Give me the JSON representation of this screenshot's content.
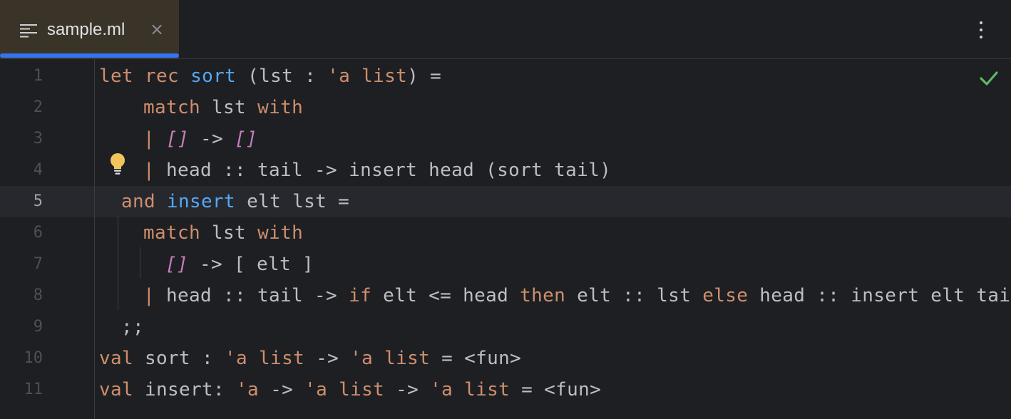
{
  "tab": {
    "title": "sample.ml",
    "close_symbol": "×",
    "file_icon": "text-file-icon"
  },
  "toolbar": {
    "more_icon": "more-vertical-icon"
  },
  "status": {
    "inspection_icon": "check-icon",
    "inspection_color": "#5fb865"
  },
  "intention": {
    "icon": "lightbulb-icon",
    "color": "#f2c55c"
  },
  "editor": {
    "current_line": 5,
    "colors": {
      "keyword": "#cf8e6d",
      "function": "#56a8f5",
      "list_literal": "#c77dbb",
      "text": "#bcbec4",
      "accent": "#3574f0"
    },
    "lines": [
      {
        "number": "1",
        "tokens": [
          {
            "t": "let",
            "c": "kw"
          },
          {
            "t": " "
          },
          {
            "t": "rec",
            "c": "kw"
          },
          {
            "t": " "
          },
          {
            "t": "sort",
            "c": "fn"
          },
          {
            "t": " (lst : "
          },
          {
            "t": "'a list",
            "c": "kw"
          },
          {
            "t": ") ="
          }
        ]
      },
      {
        "number": "2",
        "tokens": [
          {
            "t": "match",
            "c": "kw"
          },
          {
            "t": " lst "
          },
          {
            "t": "with",
            "c": "kw"
          }
        ]
      },
      {
        "number": "3",
        "tokens": [
          {
            "t": "| ",
            "c": "kw"
          },
          {
            "t": "[]",
            "c": "ls"
          },
          {
            "t": " -> "
          },
          {
            "t": "[]",
            "c": "ls"
          }
        ]
      },
      {
        "number": "4",
        "tokens": [
          {
            "t": "| ",
            "c": "kw"
          },
          {
            "t": "head :: tail -> insert head (sort tail)"
          }
        ]
      },
      {
        "number": "5",
        "tokens": [
          {
            "t": "and",
            "c": "kw"
          },
          {
            "t": " "
          },
          {
            "t": "insert",
            "c": "fn"
          },
          {
            "t": " elt lst ="
          }
        ]
      },
      {
        "number": "6",
        "tokens": [
          {
            "t": "match",
            "c": "kw"
          },
          {
            "t": " lst "
          },
          {
            "t": "with",
            "c": "kw"
          }
        ]
      },
      {
        "number": "7",
        "tokens": [
          {
            "t": "[]",
            "c": "ls"
          },
          {
            "t": " -> [ elt ]"
          }
        ]
      },
      {
        "number": "8",
        "tokens": [
          {
            "t": "| ",
            "c": "kw"
          },
          {
            "t": "head :: tail -> "
          },
          {
            "t": "if",
            "c": "kw"
          },
          {
            "t": " elt <= head "
          },
          {
            "t": "then",
            "c": "kw"
          },
          {
            "t": " elt :: lst "
          },
          {
            "t": "else",
            "c": "kw"
          },
          {
            "t": " head :: insert elt tail"
          }
        ]
      },
      {
        "number": "9",
        "tokens": [
          {
            "t": ";;"
          }
        ]
      },
      {
        "number": "10",
        "tokens": [
          {
            "t": "val",
            "c": "kw"
          },
          {
            "t": " sort : "
          },
          {
            "t": "'a list",
            "c": "kw"
          },
          {
            "t": " -> "
          },
          {
            "t": "'a list",
            "c": "kw"
          },
          {
            "t": " = <fun>"
          }
        ]
      },
      {
        "number": "11",
        "tokens": [
          {
            "t": "val",
            "c": "kw"
          },
          {
            "t": " insert: "
          },
          {
            "t": "'a",
            "c": "kw"
          },
          {
            "t": " -> "
          },
          {
            "t": "'a list",
            "c": "kw"
          },
          {
            "t": " -> "
          },
          {
            "t": "'a list",
            "c": "kw"
          },
          {
            "t": " = <fun>"
          }
        ]
      }
    ]
  }
}
